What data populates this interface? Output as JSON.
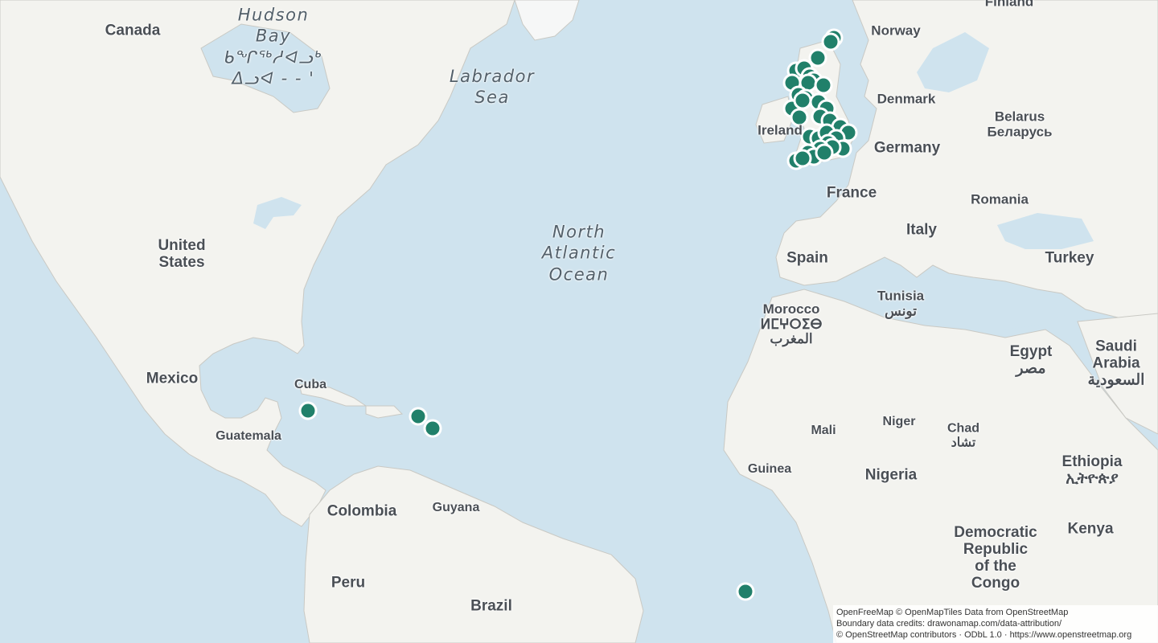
{
  "map": {
    "colors": {
      "water": "#cfe3ee",
      "land": "#f3f3ef",
      "border": "#c9c9c4",
      "marker_fill": "#21806a",
      "marker_stroke": "#ffffff",
      "ice": "#f6f7f7"
    },
    "labels": {
      "canada": "Canada",
      "hudson_bay": [
        "Hudson",
        "Bay",
        "ᑲᖏᖅᓱᐊᓗᒃ",
        "ᐃᓗᐊ - - '"
      ],
      "labrador_sea": [
        "Labrador",
        "Sea"
      ],
      "norway": "Norway",
      "finland": "Finland",
      "denmark": "Denmark",
      "ireland": "Ireland",
      "belarus": [
        "Belarus",
        "Беларусь"
      ],
      "germany": "Germany",
      "france": "France",
      "romania": "Romania",
      "italy": "Italy",
      "spain": "Spain",
      "turkey": "Turkey",
      "united_states": [
        "United",
        "States"
      ],
      "north_atlantic": [
        "North",
        "Atlantic",
        "Ocean"
      ],
      "morocco": [
        "Morocco",
        "ⵍⵎⵖⵔⵉⴱ",
        "المغرب"
      ],
      "tunisia": [
        "Tunisia",
        "تونس"
      ],
      "egypt": [
        "Egypt",
        "مصر"
      ],
      "saudi_arabia": [
        "Saudi",
        "Arabia",
        "السعودية"
      ],
      "mexico": "Mexico",
      "cuba": "Cuba",
      "guatemala": "Guatemala",
      "mali": "Mali",
      "niger": "Niger",
      "chad": [
        "Chad",
        "تشاد"
      ],
      "guinea": "Guinea",
      "nigeria": "Nigeria",
      "ethiopia": [
        "Ethiopia",
        "ኢትዮጵያ"
      ],
      "colombia": "Colombia",
      "guyana": "Guyana",
      "peru": "Peru",
      "brazil": "Brazil",
      "drc": [
        "Democratic",
        "Republic",
        "of the",
        "Congo"
      ],
      "kenya": "Kenya"
    }
  },
  "attribution": {
    "line1": "OpenFreeMap © OpenMapTiles Data from OpenStreetMap",
    "line2": "Boundary data credits: drawonamap.com/data-attribution/",
    "line3": "© OpenStreetMap contributors · ODbL 1.0 · https://www.openstreetmap.org"
  }
}
